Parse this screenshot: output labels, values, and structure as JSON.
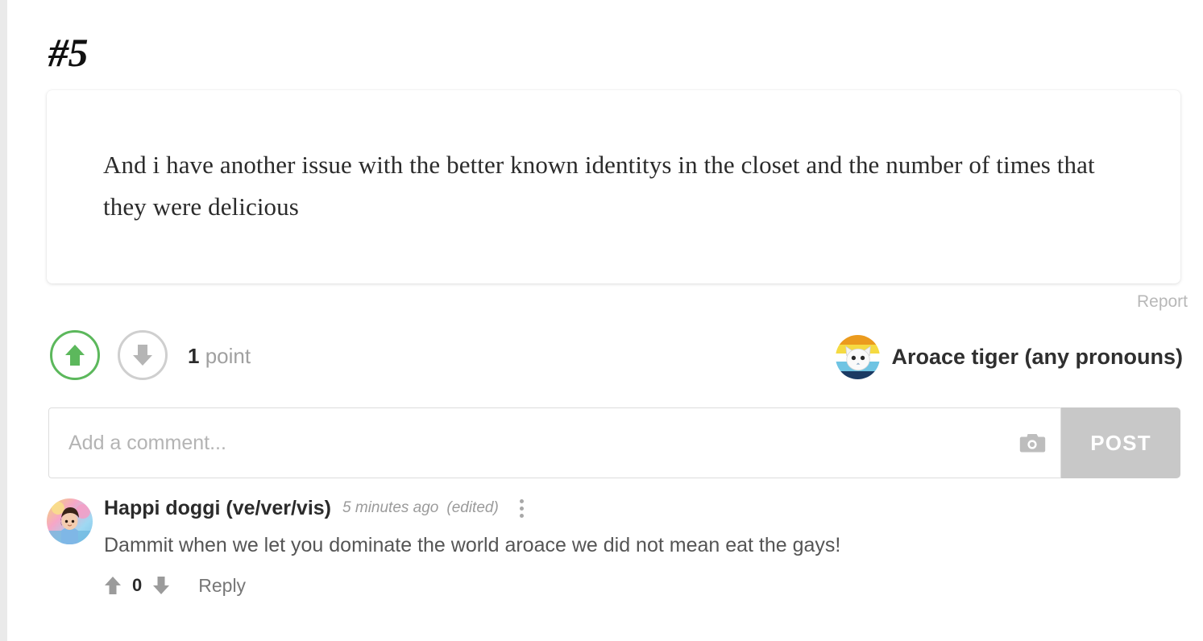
{
  "post": {
    "number_label": "#5",
    "body": "And i have another issue with the better known identitys in the closet and the number of times that they were delicious",
    "report_label": "Report",
    "score_value": "1",
    "score_label": "point",
    "author_name": "Aroace tiger (any pronouns)",
    "upvote_icon": "arrow-up-icon",
    "downvote_icon": "arrow-down-icon",
    "upvote_active_color": "#5cb85c",
    "downvote_color": "#b5b5b5",
    "avatar_icon": "aroace-cat-avatar"
  },
  "composer": {
    "placeholder": "Add a comment...",
    "value": "",
    "camera_icon": "camera-icon",
    "post_label": "POST",
    "post_button_color": "#c8c8c8"
  },
  "comments": [
    {
      "author": "Happi doggi (ve/ver/vis)",
      "timestamp": "5 minutes ago",
      "edited_label": "(edited)",
      "menu_icon": "more-vertical-icon",
      "text": "Dammit when we let you dominate the world aroace we did not mean eat the gays!",
      "score": "0",
      "reply_label": "Reply",
      "upvote_icon": "arrow-up-icon",
      "downvote_icon": "arrow-down-icon",
      "avatar_icon": "happi-doggi-avatar"
    }
  ]
}
